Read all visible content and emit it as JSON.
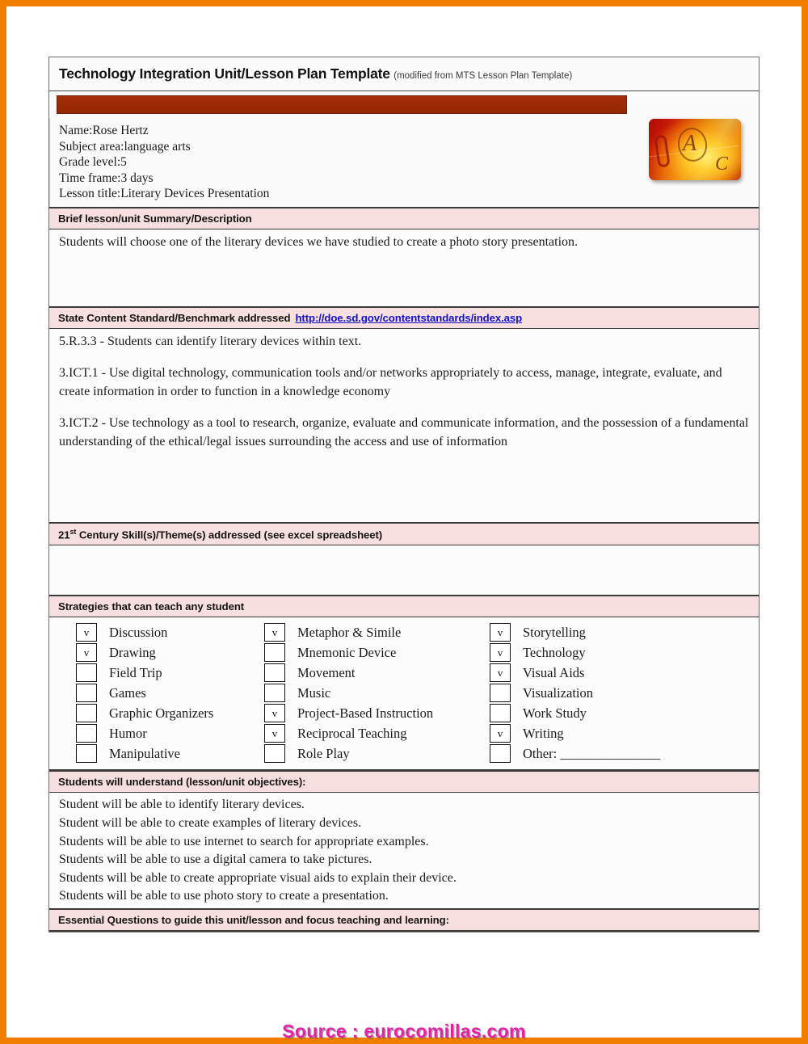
{
  "document": {
    "title": "Technology Integration Unit/Lesson Plan Template",
    "title_note": "(modified from MTS Lesson Plan Template)",
    "thumbnail_marks": {
      "a": "A",
      "c": "C"
    },
    "info_lines": [
      "Name:Rose Hertz",
      "Subject area:language arts",
      "Grade level:5",
      "Time frame:3 days",
      "Lesson title:Literary Devices Presentation"
    ],
    "sections": {
      "summary": {
        "header": "Brief lesson/unit Summary/Description",
        "body": "Students will choose one of the literary devices we have studied to create a photo story presentation."
      },
      "standards": {
        "header": "State Content Standard/Benchmark addressed",
        "url": "http://doe.sd.gov/contentstandards/index.asp",
        "items": [
          "5.R.3.3 - Students can identify literary devices within text.",
          "3.ICT.1 - Use digital technology, communication tools and/or networks appropriately to access, manage, integrate, evaluate, and create information in order to function in a knowledge economy",
          "3.ICT.2 - Use technology as a tool to research, organize, evaluate and communicate information, and the possession of a fundamental understanding of the ethical/legal issues surrounding the access and use of information"
        ]
      },
      "century21": {
        "header_prefix": "21",
        "header_sup": "st",
        "header_rest": " Century Skill(s)/Theme(s) addressed  (see excel spreadsheet)",
        "body": ""
      },
      "strategies": {
        "header": "Strategies that can teach any student",
        "checked_glyph": "v",
        "columns": [
          [
            {
              "label": "Discussion",
              "checked": true
            },
            {
              "label": "Drawing",
              "checked": true
            },
            {
              "label": "Field Trip",
              "checked": false
            },
            {
              "label": "Games",
              "checked": false
            },
            {
              "label": "Graphic Organizers",
              "checked": false
            },
            {
              "label": "Humor",
              "checked": false
            },
            {
              "label": "Manipulative",
              "checked": false
            }
          ],
          [
            {
              "label": "Metaphor & Simile",
              "checked": true
            },
            {
              "label": "Mnemonic Device",
              "checked": false
            },
            {
              "label": "Movement",
              "checked": false
            },
            {
              "label": "Music",
              "checked": false
            },
            {
              "label": "Project-Based Instruction",
              "checked": true
            },
            {
              "label": "Reciprocal Teaching",
              "checked": true
            },
            {
              "label": "Role Play",
              "checked": false
            }
          ],
          [
            {
              "label": "Storytelling",
              "checked": true
            },
            {
              "label": "Technology",
              "checked": true
            },
            {
              "label": "Visual Aids",
              "checked": true
            },
            {
              "label": "Visualization",
              "checked": false
            },
            {
              "label": "Work Study",
              "checked": false
            },
            {
              "label": "Writing",
              "checked": true
            },
            {
              "label": "Other: _______________",
              "checked": false
            }
          ]
        ]
      },
      "objectives": {
        "header": "Students will understand (lesson/unit objectives):",
        "items": [
          "Student will be able to identify literary devices.",
          "Student will be able to create examples of literary devices.",
          "Students will be able to use internet to search for appropriate examples.",
          "Students will be able to use a digital camera to take pictures.",
          "Students will be able to create appropriate visual aids to explain their device.",
          "Students will be able to use photo story to create a presentation."
        ]
      },
      "essential_questions": {
        "header": "Essential Questions to guide this unit/lesson and focus teaching and learning:"
      }
    }
  },
  "footer": {
    "source": "Source : eurocomillas.com"
  },
  "colors": {
    "frame": "#f07d00",
    "banner": "#9e2b06",
    "section_header_bg": "#f8dfdf",
    "link": "#1111cc",
    "source_text": "#e81fa8"
  }
}
